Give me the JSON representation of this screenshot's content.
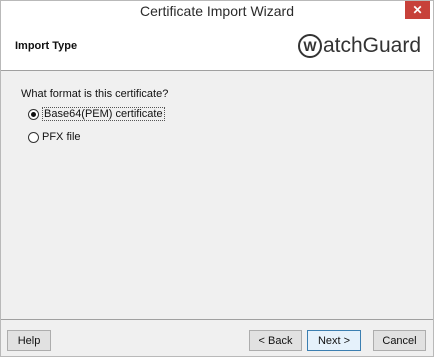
{
  "window": {
    "title": "Certificate Import Wizard",
    "close_glyph": "✕"
  },
  "header": {
    "title": "Import Type",
    "logo": {
      "mark": "W",
      "text": "atchGuard",
      "icon": "watchguard-logo-icon"
    }
  },
  "main": {
    "question": "What format is this certificate?",
    "options": [
      {
        "label": "Base64(PEM) certificate",
        "selected": true
      },
      {
        "label": "PFX file",
        "selected": false
      }
    ]
  },
  "footer": {
    "help_label": "Help",
    "back_label": "< Back",
    "next_label": "Next >",
    "cancel_label": "Cancel"
  }
}
